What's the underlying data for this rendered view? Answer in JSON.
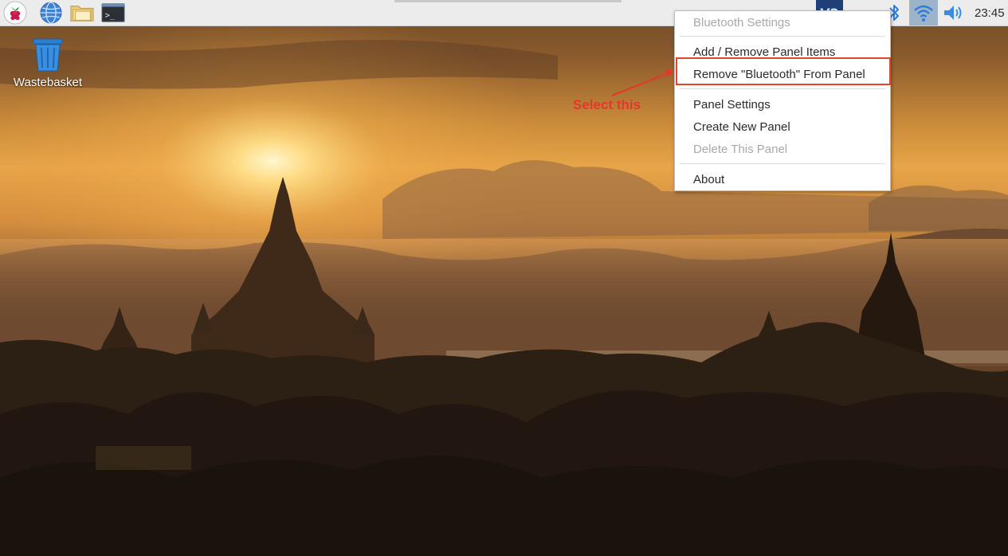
{
  "taskbar": {
    "launchers": [
      {
        "name": "raspberry-menu",
        "icon": "raspberry-icon"
      },
      {
        "name": "web-browser",
        "icon": "globe-icon"
      },
      {
        "name": "file-manager",
        "icon": "folder-icon"
      },
      {
        "name": "terminal",
        "icon": "terminal-icon"
      }
    ],
    "tray": {
      "vnc_label": "V2",
      "bluetooth_icon": "bluetooth-icon",
      "wifi_icon": "wifi-icon",
      "volume_icon": "volume-icon"
    },
    "clock": "23:45"
  },
  "desktop": {
    "icons": [
      {
        "label": "Wastebasket",
        "icon": "wastebasket-icon"
      }
    ]
  },
  "context_menu": {
    "items": [
      {
        "label": "Bluetooth Settings",
        "enabled": false
      },
      {
        "label": "Add / Remove Panel Items",
        "enabled": true
      },
      {
        "label": "Remove \"Bluetooth\" From Panel",
        "enabled": true,
        "highlighted": true
      },
      {
        "label": "Panel Settings",
        "enabled": true
      },
      {
        "label": "Create New Panel",
        "enabled": true
      },
      {
        "label": "Delete This Panel",
        "enabled": false
      },
      {
        "label": "About",
        "enabled": true
      }
    ]
  },
  "annotation": {
    "text": "Select this",
    "color": "#e3382a"
  },
  "colors": {
    "panel": "#ececec",
    "accent_blue": "#2f7bd9",
    "highlight_border": "#e0452d"
  }
}
